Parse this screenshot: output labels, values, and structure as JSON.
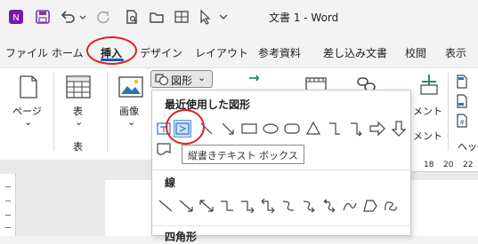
{
  "window": {
    "doc_title": "文書 1  -  Word"
  },
  "quick_access": {
    "icons": [
      "onenote-icon",
      "save-icon",
      "undo-icon",
      "dropdown-icon",
      "redo-icon",
      "file-icon",
      "folder-icon",
      "cursor-icon",
      "more-icon"
    ]
  },
  "tabs": [
    {
      "label": "ファイル"
    },
    {
      "label": "ホーム"
    },
    {
      "label": "挿入"
    },
    {
      "label": "デザイン"
    },
    {
      "label": "レイアウト"
    },
    {
      "label": "参考資料"
    },
    {
      "label": "差し込み文書"
    },
    {
      "label": "校閲"
    },
    {
      "label": "表示"
    }
  ],
  "ribbon": {
    "page_label": "ページ",
    "table_label": "表",
    "table_group_label": "表",
    "image_label": "画像",
    "shapes_button": "図形",
    "comment_label": "メント",
    "header_label": "ヘッ",
    "chevron": "⌄"
  },
  "dropdown": {
    "recent_title": "最近使用した図形",
    "lines_title": "線",
    "rect_title": "四角形",
    "tooltip": "縦書きテキスト ボックス"
  },
  "ruler": {
    "marks": [
      "18",
      "20",
      "22"
    ]
  }
}
